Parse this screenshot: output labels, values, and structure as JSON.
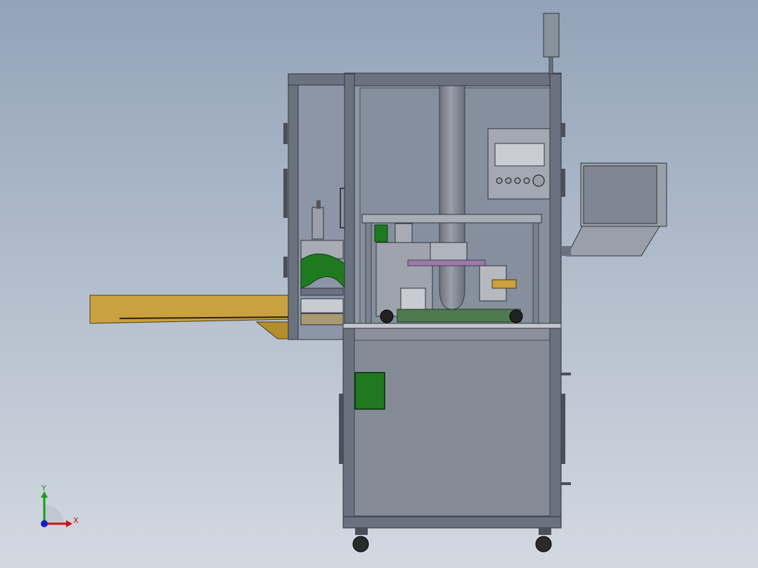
{
  "viewport": {
    "background_top": "#93a3b8",
    "background_bottom": "#d3d9e1"
  },
  "colors": {
    "frame": "#5a6270",
    "frame_dark": "#2f343c",
    "panel_glass": "#8c96a6",
    "panel_body": "#8a909c",
    "conveyor": "#c9a23f",
    "conveyor_dark": "#6d5617",
    "green_part": "#1f7a1f",
    "hmi_screen": "#c9ccd2",
    "monitor_screen": "#7f8794"
  },
  "triad": {
    "x_label": "X",
    "y_label": "Y",
    "x_color": "#d01010",
    "y_color": "#12a012",
    "z_color": "#1020c0"
  }
}
